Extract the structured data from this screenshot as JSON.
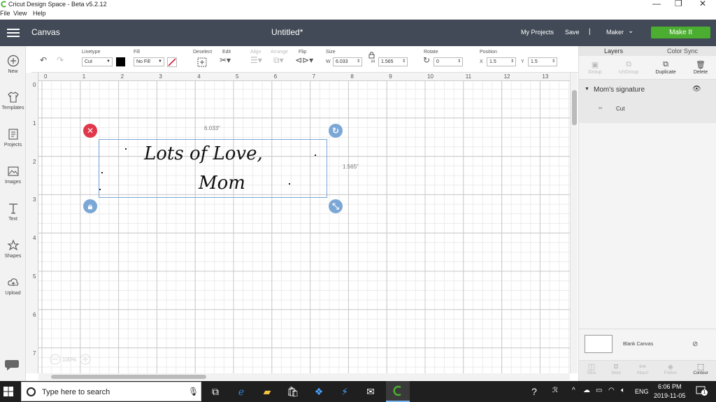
{
  "window": {
    "title": "Cricut Design Space - Beta v5.2.12",
    "menu": [
      "File",
      "View",
      "Help"
    ],
    "controls": {
      "minimize": "—",
      "maximize": "❐",
      "close": "✕"
    }
  },
  "header": {
    "section": "Canvas",
    "doc_title": "Untitled*",
    "my_projects": "My Projects",
    "save": "Save",
    "separator": "|",
    "machine": "Maker",
    "make_it": "Make It",
    "make_it_color": "#4cae30",
    "bg_color": "#414a56"
  },
  "sidebar": {
    "items": [
      {
        "icon": "plus-circle-icon",
        "label": "New"
      },
      {
        "icon": "tshirt-icon",
        "label": "Templates"
      },
      {
        "icon": "projects-icon",
        "label": "Projects"
      },
      {
        "icon": "image-icon",
        "label": "Images"
      },
      {
        "icon": "text-icon",
        "label": "Text"
      },
      {
        "icon": "shapes-icon",
        "label": "Shapes"
      },
      {
        "icon": "upload-icon",
        "label": "Upload"
      }
    ]
  },
  "toolbar": {
    "linetype_label": "Linetype",
    "linetype_value": "Cut",
    "fill_label": "Fill",
    "fill_value": "No Fill",
    "deselect_label": "Deselect",
    "edit_label": "Edit",
    "align_label": "Align",
    "arrange_label": "Arrange",
    "flip_label": "Flip",
    "size_label": "Size",
    "size_w_prefix": "W",
    "size_w": "6.033",
    "size_h_prefix": "H",
    "size_h": "1.565",
    "rotate_label": "Rotate",
    "rotate_value": "0",
    "position_label": "Position",
    "pos_x_prefix": "X",
    "pos_x": "1.5",
    "pos_y_prefix": "Y",
    "pos_y": "1.5"
  },
  "canvas": {
    "ruler_top": [
      "0",
      "1",
      "2",
      "3",
      "4",
      "5",
      "6",
      "7",
      "8",
      "9",
      "10",
      "11",
      "12",
      "13"
    ],
    "ruler_left": [
      "0",
      "1",
      "2",
      "3",
      "4",
      "5",
      "6",
      "7"
    ],
    "selection_width": "6.033\"",
    "selection_height": "1.565\"",
    "signature_line1": "Lots of Love,",
    "signature_line2": "Mom",
    "zoom": "100%",
    "selection_color": "#7ba7d6",
    "delete_handle_color": "#e0374a",
    "handle_color": "#7ba7d6"
  },
  "layers_panel": {
    "tabs": [
      "Layers",
      "Color Sync"
    ],
    "actions": [
      {
        "icon": "group-icon",
        "label": "Group",
        "enabled": false
      },
      {
        "icon": "ungroup-icon",
        "label": "UnGroup",
        "enabled": false
      },
      {
        "icon": "duplicate-icon",
        "label": "Duplicate",
        "enabled": true
      },
      {
        "icon": "trash-icon",
        "label": "Delete",
        "enabled": true
      }
    ],
    "layer_group": "Mom's signature",
    "layer_item": "Cut",
    "blank_canvas": "Blank Canvas",
    "bottom_tools": [
      {
        "icon": "slice-icon",
        "label": "Slice",
        "enabled": false
      },
      {
        "icon": "weld-icon",
        "label": "Weld",
        "enabled": false
      },
      {
        "icon": "attach-icon",
        "label": "Attach",
        "enabled": false
      },
      {
        "icon": "flatten-icon",
        "label": "Flatten",
        "enabled": false
      },
      {
        "icon": "contour-icon",
        "label": "Contour",
        "enabled": true
      }
    ]
  },
  "taskbar": {
    "search_placeholder": "Type here to search",
    "language": "ENG",
    "time": "6:06 PM",
    "date": "2019-11-05",
    "notifications": "1"
  }
}
